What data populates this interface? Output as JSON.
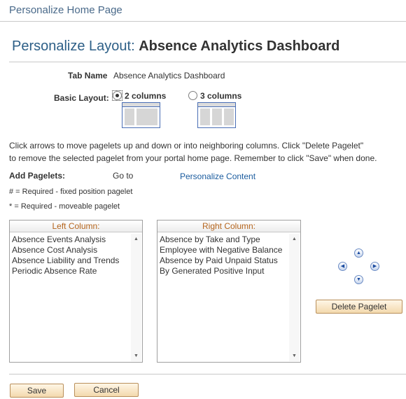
{
  "page": {
    "header": "Personalize Home Page"
  },
  "layout": {
    "title_prefix": "Personalize Layout:",
    "title_name": "Absence Analytics Dashboard",
    "tab_name_label": "Tab Name",
    "tab_name_value": "Absence Analytics Dashboard",
    "basic_layout_label": "Basic Layout:",
    "option_two": "2 columns",
    "option_three": "3 columns",
    "selected_option": "2 columns"
  },
  "instructions": {
    "line1": "Click arrows to move pagelets up and down or into neighboring columns. Click \"Delete Pagelet\"",
    "line2": "to remove the selected pagelet from your portal home page. Remember to click \"Save\" when done."
  },
  "pagelets": {
    "add_label": "Add Pagelets:",
    "goto_label": "Go to",
    "personalize_link": "Personalize Content",
    "note_required_fixed": "# = Required - fixed position pagelet",
    "note_required_moveable": "* = Required - moveable pagelet"
  },
  "left_column": {
    "header": "Left Column:",
    "items": [
      "Absence Events Analysis",
      "Absence Cost Analysis",
      "Absence Liability and Trends",
      "Periodic Absence Rate"
    ]
  },
  "right_column": {
    "header": "Right Column:",
    "items": [
      "Absence by Take and Type",
      "Employee with Negative Balance",
      "Absence by Paid Unpaid Status",
      "By Generated Positive Input"
    ]
  },
  "controls": {
    "delete_label": "Delete Pagelet",
    "move_icons": [
      "arrow-up-icon",
      "arrow-left-icon",
      "arrow-right-icon",
      "arrow-down-icon"
    ]
  },
  "footer": {
    "save_label": "Save",
    "cancel_label": "Cancel"
  },
  "colors": {
    "title_blue": "#2d5f87",
    "link_blue": "#1a5b9e",
    "column_header_orange": "#b5651d",
    "button_fill": "#f3d9ad"
  }
}
